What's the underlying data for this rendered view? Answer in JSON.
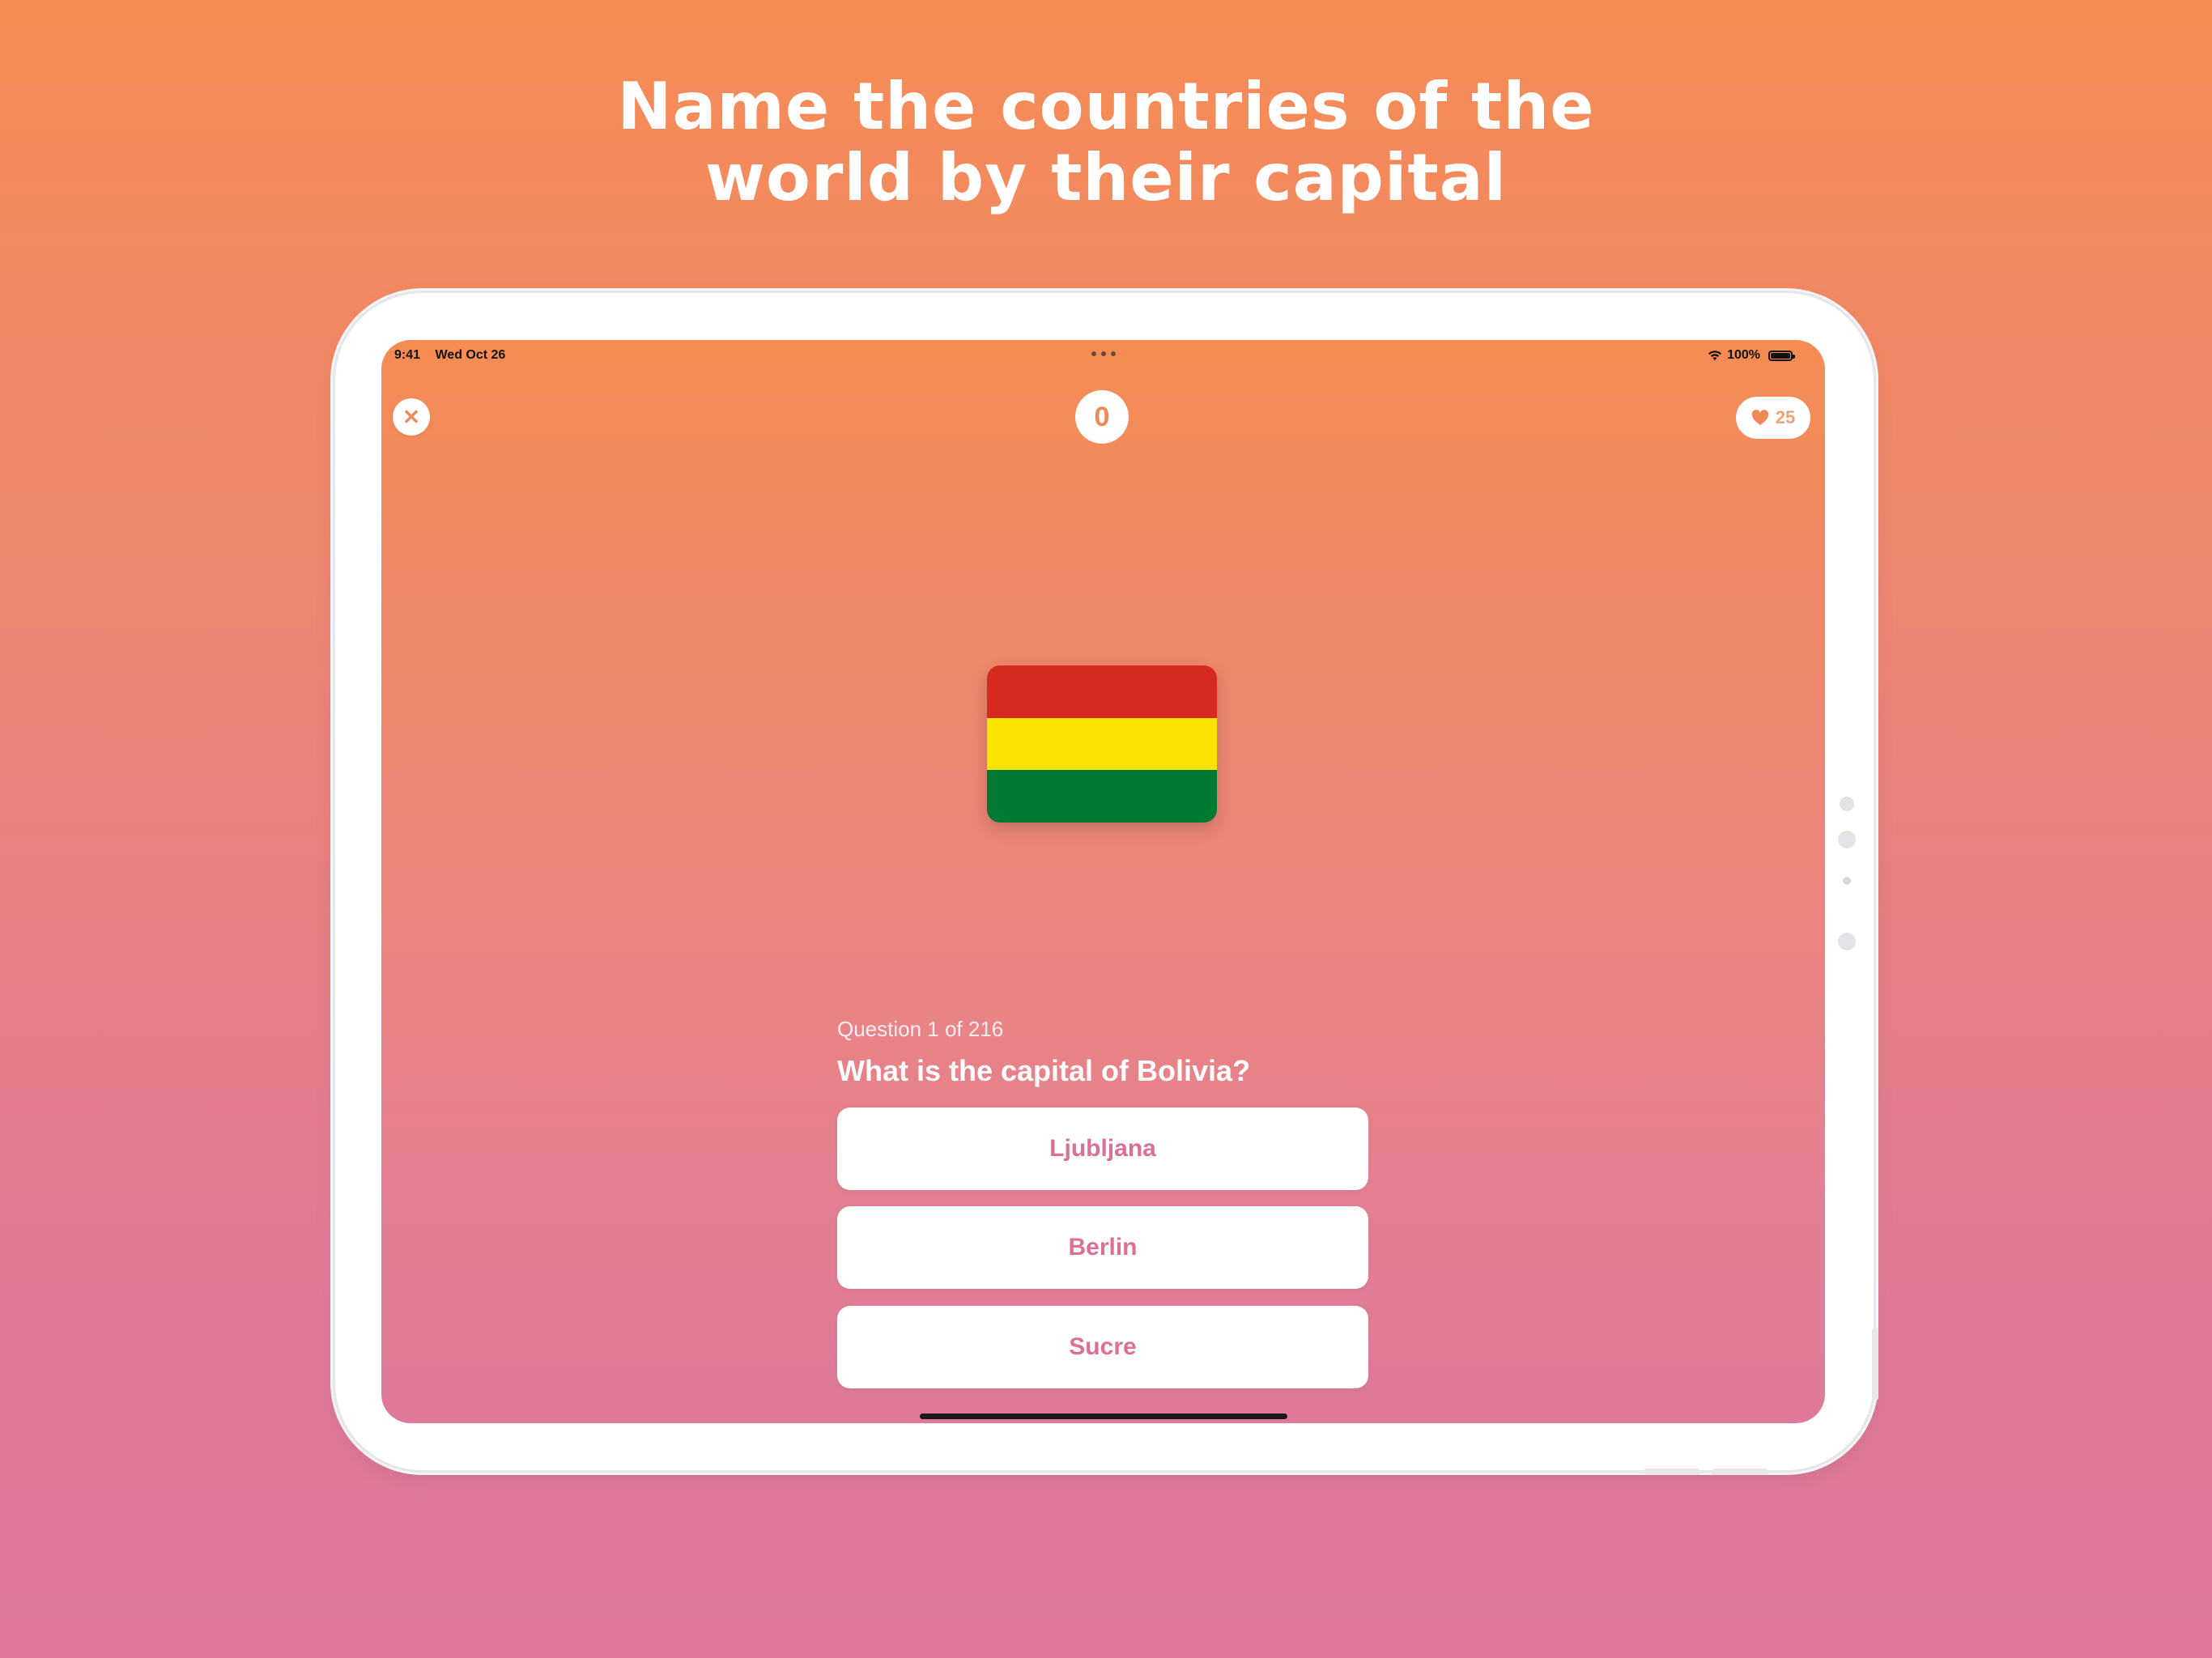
{
  "headline": {
    "line1": "Name the countries  of the",
    "line2": "world by their capital"
  },
  "status_bar": {
    "time": "9:41",
    "date": "Wed Oct 26",
    "battery": "100%"
  },
  "top_bar": {
    "close_symbol": "✕",
    "score": "0",
    "lives": "25"
  },
  "flag": {
    "country": "Bolivia",
    "stripes": [
      "#d52b1e",
      "#f9e300",
      "#007a33"
    ]
  },
  "question": {
    "progress": "Question 1 of 216",
    "text": "What is the capital of Bolivia?"
  },
  "answers": [
    "Ljubljana",
    "Berlin",
    "Sucre"
  ]
}
